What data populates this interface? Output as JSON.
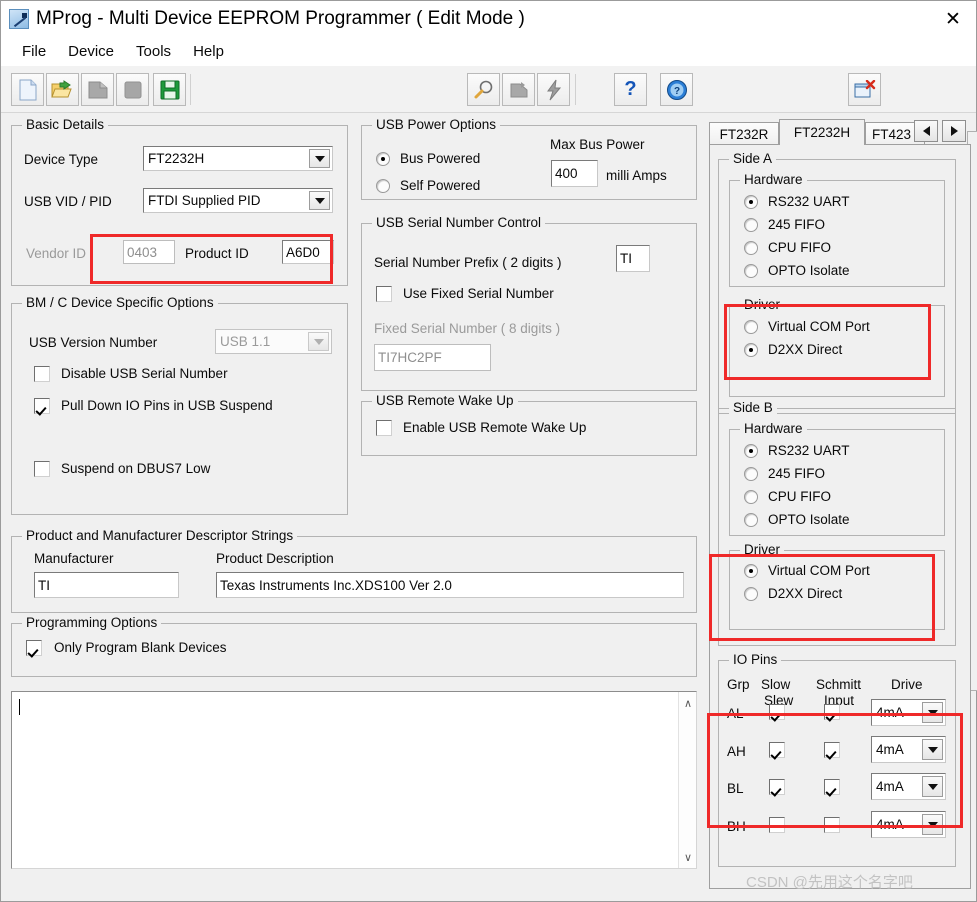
{
  "window": {
    "title": "MProg - Multi Device EEPROM Programmer ( Edit Mode )",
    "app_icon": "mprog-app-icon",
    "close_label": "✕"
  },
  "menubar": {
    "items": [
      {
        "label": "File"
      },
      {
        "label": "Device"
      },
      {
        "label": "Tools"
      },
      {
        "label": "Help"
      }
    ]
  },
  "toolbar": {
    "buttons": [
      {
        "name": "new-icon",
        "tooltip": "New"
      },
      {
        "name": "open-folder-icon",
        "tooltip": "Open"
      },
      {
        "name": "save-as-icon",
        "tooltip": "Save As"
      },
      {
        "name": "stop-icon",
        "tooltip": "Stop"
      },
      {
        "name": "save-disk-icon",
        "tooltip": "Save"
      },
      {
        "name": "scan-magnifier-icon",
        "tooltip": "Scan"
      },
      {
        "name": "erase-icon",
        "tooltip": "Erase"
      },
      {
        "name": "program-lightning-icon",
        "tooltip": "Program"
      },
      {
        "name": "help-question-icon",
        "tooltip": "Help"
      },
      {
        "name": "about-info-icon",
        "tooltip": "About"
      },
      {
        "name": "close-window-icon",
        "tooltip": "Exit"
      }
    ]
  },
  "basic_details": {
    "title": "Basic Details",
    "device_type_label": "Device Type",
    "device_type_value": "FT2232H",
    "usb_vid_pid_label": "USB VID / PID",
    "usb_vid_pid_value": "FTDI Supplied PID",
    "vendor_id_label": "Vendor ID",
    "vendor_id_value": "0403",
    "product_id_label": "Product ID",
    "product_id_value": "A6D0"
  },
  "bm_c_options": {
    "title": "BM / C Device Specific Options",
    "usb_version_label": "USB Version Number",
    "usb_version_value": "USB 1.1",
    "disable_usb_serial": {
      "label": "Disable USB Serial Number",
      "checked": false
    },
    "pull_down_io": {
      "label": "Pull Down IO Pins in USB Suspend",
      "checked": true
    },
    "suspend_dbus7": {
      "label": "Suspend on DBUS7 Low",
      "checked": false
    }
  },
  "descriptor_strings": {
    "title": "Product and Manufacturer Descriptor Strings",
    "manufacturer_label": "Manufacturer",
    "manufacturer_value": "TI",
    "product_description_label": "Product Description",
    "product_description_value": "Texas Instruments Inc.XDS100 Ver 2.0"
  },
  "programming_options": {
    "title": "Programming Options",
    "only_blank": {
      "label": "Only Program Blank Devices",
      "checked": true
    }
  },
  "usb_power": {
    "title": "USB Power Options",
    "bus_powered": {
      "label": "Bus Powered",
      "selected": true
    },
    "self_powered": {
      "label": "Self Powered",
      "selected": false
    },
    "max_bus_power_label": "Max Bus Power",
    "max_bus_power_value": "400",
    "milli_amps_label": "milli Amps"
  },
  "serial_control": {
    "title": "USB Serial Number Control",
    "prefix_label": "Serial Number Prefix ( 2 digits )",
    "prefix_value": "TI",
    "use_fixed": {
      "label": "Use Fixed Serial Number",
      "checked": false
    },
    "fixed_label": "Fixed Serial Number ( 8 digits )",
    "fixed_value": "TI7HC2PF"
  },
  "remote_wakeup": {
    "title": "USB Remote Wake Up",
    "enable": {
      "label": "Enable USB Remote Wake Up",
      "checked": false
    }
  },
  "tabs": {
    "items": [
      {
        "label": "FT232R",
        "active": false
      },
      {
        "label": "FT2232H",
        "active": true
      },
      {
        "label": "FT423",
        "active": false
      }
    ],
    "scroll_left": "◄",
    "scroll_right": "►"
  },
  "side_a": {
    "title": "Side A",
    "hardware": {
      "title": "Hardware",
      "options": [
        {
          "label": "RS232 UART",
          "selected": true
        },
        {
          "label": "245 FIFO",
          "selected": false
        },
        {
          "label": "CPU FIFO",
          "selected": false
        },
        {
          "label": "OPTO Isolate",
          "selected": false
        }
      ]
    },
    "driver": {
      "title": "Driver",
      "options": [
        {
          "label": "Virtual COM Port",
          "selected": false
        },
        {
          "label": "D2XX Direct",
          "selected": true
        }
      ]
    }
  },
  "side_b": {
    "title": "Side B",
    "hardware": {
      "title": "Hardware",
      "options": [
        {
          "label": "RS232 UART",
          "selected": true
        },
        {
          "label": "245 FIFO",
          "selected": false
        },
        {
          "label": "CPU FIFO",
          "selected": false
        },
        {
          "label": "OPTO Isolate",
          "selected": false
        }
      ]
    },
    "driver": {
      "title": "Driver",
      "options": [
        {
          "label": "Virtual COM Port",
          "selected": true
        },
        {
          "label": "D2XX Direct",
          "selected": false
        }
      ]
    }
  },
  "io_pins": {
    "title": "IO Pins",
    "headers": {
      "grp": "Grp",
      "slow_slew_line1": "Slow",
      "slow_slew_line2": "Slew",
      "schmitt_line1": "Schmitt",
      "schmitt_line2": "Input",
      "drive": "Drive"
    },
    "rows": [
      {
        "grp": "AL",
        "slow_slew": true,
        "schmitt": true,
        "drive": "4mA"
      },
      {
        "grp": "AH",
        "slow_slew": true,
        "schmitt": true,
        "drive": "4mA"
      },
      {
        "grp": "BL",
        "slow_slew": true,
        "schmitt": true,
        "drive": "4mA"
      },
      {
        "grp": "BH",
        "slow_slew": false,
        "schmitt": false,
        "drive": "4mA"
      }
    ]
  },
  "log": {
    "value": "",
    "scroll_up": "∧",
    "scroll_down": "∨"
  },
  "watermark": {
    "text": "CSDN @先用这个名字吧"
  },
  "annotations": {
    "highlight_color": "#ef2929",
    "boxes": [
      {
        "name": "vendor-product-id-highlight"
      },
      {
        "name": "side-a-driver-highlight"
      },
      {
        "name": "side-b-driver-highlight"
      },
      {
        "name": "io-pins-rows-highlight"
      }
    ]
  }
}
